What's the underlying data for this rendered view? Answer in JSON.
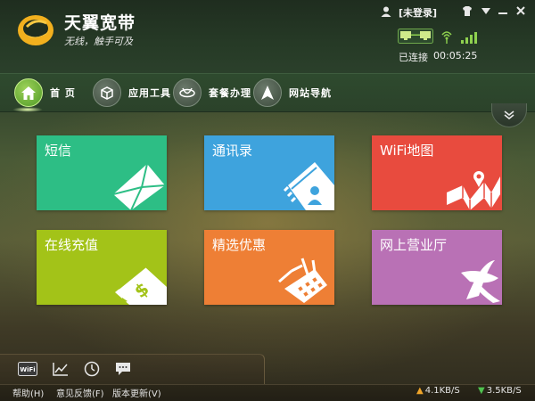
{
  "app": {
    "name": "天翼宽带",
    "slogan": "无线，触手可及"
  },
  "header": {
    "user_status": "[未登录]",
    "connection_status": "已连接",
    "connection_time": "00:05:25",
    "controls": [
      "skin-icon",
      "menu-icon",
      "minimize-icon",
      "close-icon"
    ]
  },
  "nav": {
    "items": [
      {
        "label": "首 页",
        "icon": "home-icon",
        "active": true
      },
      {
        "label": "应用工具",
        "icon": "toolbox-icon",
        "active": false
      },
      {
        "label": "套餐办理",
        "icon": "telecom-icon",
        "active": false
      },
      {
        "label": "网站导航",
        "icon": "navigation-icon",
        "active": false
      }
    ]
  },
  "tiles": [
    {
      "label": "短信",
      "color": "#2dbe85",
      "icon": "envelope-icon"
    },
    {
      "label": "通讯录",
      "color": "#3ea3dd",
      "icon": "contacts-icon"
    },
    {
      "label": "WiFi地图",
      "color": "#e84b3e",
      "icon": "map-icon"
    },
    {
      "label": "在线充值",
      "color": "#a3c318",
      "icon": "card-icon"
    },
    {
      "label": "精选优惠",
      "color": "#ee7f35",
      "icon": "basket-icon"
    },
    {
      "label": "网上营业厅",
      "color": "#b971b5",
      "icon": "china-telecom-logo"
    }
  ],
  "toolbar": {
    "tools": [
      {
        "icon": "wifi-icon",
        "label": "WiFi"
      },
      {
        "icon": "chart-icon"
      },
      {
        "icon": "speedometer-icon"
      },
      {
        "icon": "chat-icon"
      }
    ]
  },
  "statusbar": {
    "help": "帮助(H)",
    "feedback": "意见反馈(F)",
    "update": "版本更新(V)",
    "upload_speed": "4.1KB/S",
    "download_speed": "3.5KB/S"
  },
  "colors": {
    "accent_green": "#8fd14f",
    "upload_arrow": "#f0a52a",
    "download_arrow": "#4fc24f"
  }
}
